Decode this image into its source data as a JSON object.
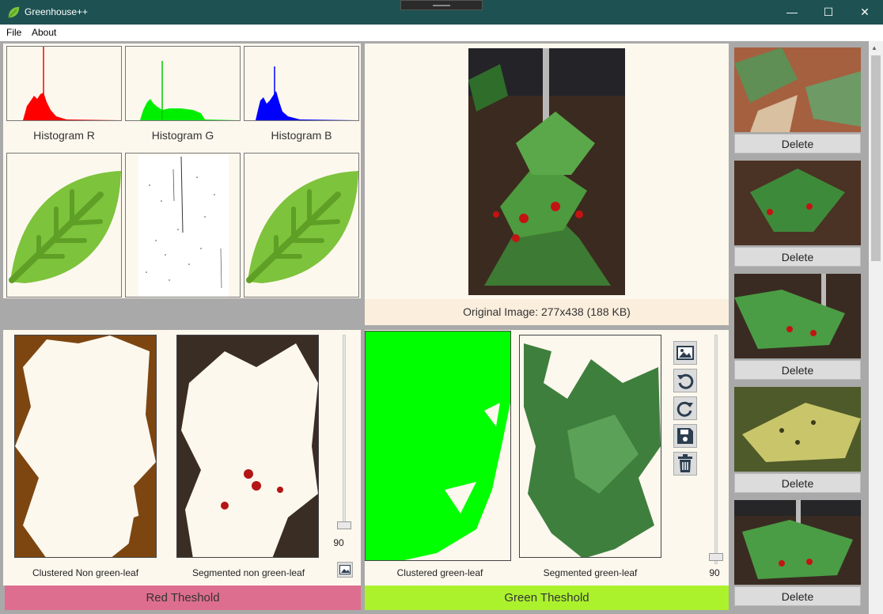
{
  "window": {
    "title": "Greenhouse++",
    "controls": {
      "minimize": "—",
      "maximize": "☐",
      "close": "✕"
    }
  },
  "menu": {
    "file": "File",
    "about": "About"
  },
  "histograms": {
    "r_label": "Histogram R",
    "g_label": "Histogram G",
    "b_label": "Histogram B"
  },
  "original": {
    "caption": "Original Image: 277x438 (188 KB)"
  },
  "red_section": {
    "clustered_label": "Clustered Non green-leaf",
    "segmented_label": "Segmented non green-leaf",
    "slider_value": "90",
    "threshold_label": "Red Theshold",
    "color": "#dd6e8f"
  },
  "green_section": {
    "clustered_label": "Clustered green-leaf",
    "segmented_label": "Segmented green-leaf",
    "slider_value": "90",
    "threshold_label": "Green Theshold",
    "color": "#abf22d"
  },
  "gallery": {
    "items": [
      {
        "delete_label": "Delete"
      },
      {
        "delete_label": "Delete"
      },
      {
        "delete_label": "Delete"
      },
      {
        "delete_label": "Delete"
      },
      {
        "delete_label": "Delete"
      }
    ]
  }
}
